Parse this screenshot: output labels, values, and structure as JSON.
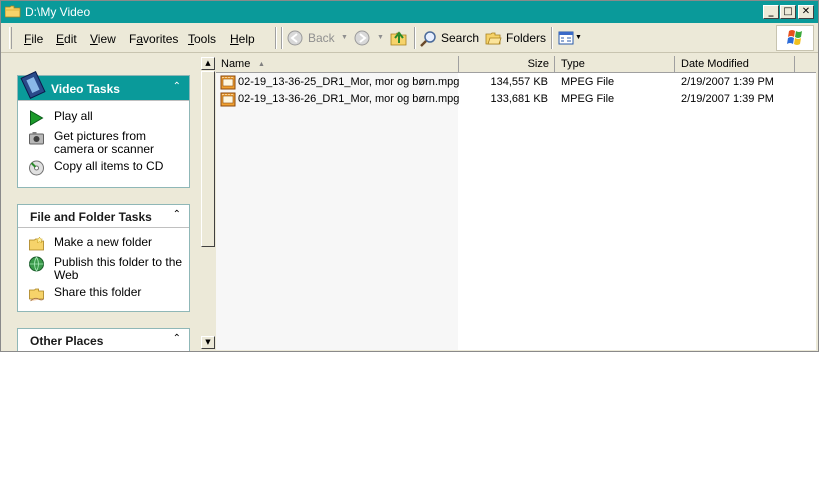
{
  "window": {
    "title": "D:\\My Video"
  },
  "caption_buttons": {
    "minimize": "_",
    "maximize": "□",
    "close": "✕"
  },
  "menu": {
    "file": {
      "acc": "F",
      "rest": "ile"
    },
    "edit": {
      "acc": "E",
      "rest": "dit"
    },
    "view": {
      "acc": "V",
      "rest": "iew"
    },
    "favorites": {
      "pre": "F",
      "acc": "a",
      "rest": "vorites"
    },
    "tools": {
      "acc": "T",
      "rest": "ools"
    },
    "help": {
      "acc": "H",
      "rest": "elp"
    }
  },
  "toolbar": {
    "back": "Back",
    "search": "Search",
    "folders": "Folders"
  },
  "video_tasks": {
    "title": "Video Tasks",
    "items": [
      {
        "label": "Play all",
        "icon": "play-icon"
      },
      {
        "label": "Get pictures from camera or scanner",
        "icon": "camera-icon"
      },
      {
        "label": "Copy all items to CD",
        "icon": "cd-copy-icon"
      }
    ]
  },
  "file_folder_tasks": {
    "title": "File and Folder Tasks",
    "items": [
      {
        "label": "Make a new folder",
        "icon": "new-folder-icon"
      },
      {
        "label": "Publish this folder to the Web",
        "icon": "globe-icon"
      },
      {
        "label": "Share this folder",
        "icon": "share-folder-icon"
      }
    ]
  },
  "other_places": {
    "title": "Other Places"
  },
  "columns": {
    "name": "Name",
    "size": "Size",
    "type": "Type",
    "date": "Date Modified"
  },
  "files": [
    {
      "name": "02-19_13-36-25_DR1_Mor, mor og børn.mpg",
      "size": "134,557 KB",
      "type": "MPEG File",
      "date": "2/19/2007 1:39 PM"
    },
    {
      "name": "02-19_13-36-26_DR1_Mor, mor og børn.mpg",
      "size": "133,681 KB",
      "type": "MPEG File",
      "date": "2/19/2007 1:39 PM"
    }
  ],
  "colors": {
    "titlebar": "#0a9a9a",
    "chrome": "#ece9d8",
    "panel_border": "#8fb7b7"
  }
}
